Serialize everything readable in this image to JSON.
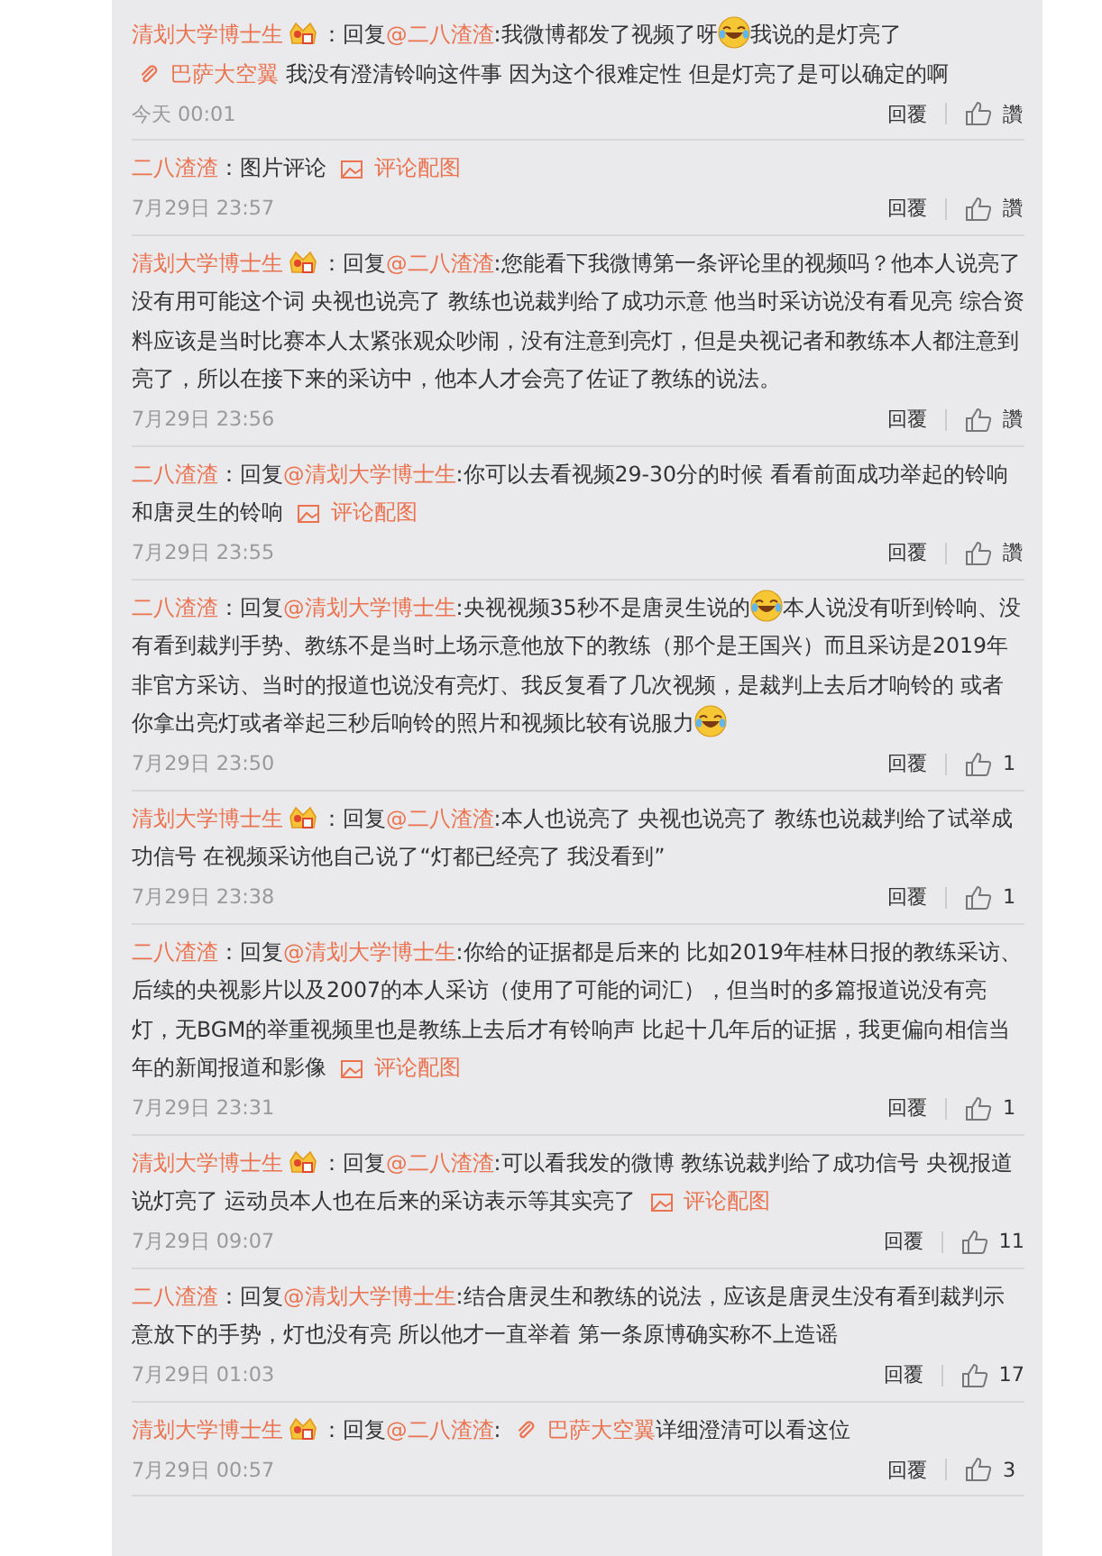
{
  "comments": [
    {
      "author": "清划大学博士生",
      "badge": true,
      "segments": [
        {
          "kind": "text",
          "text": "：回复"
        },
        {
          "kind": "mention",
          "text": "@二八渣渣"
        },
        {
          "kind": "text",
          "text": ":我微博都发了视频了呀"
        },
        {
          "kind": "emoji"
        },
        {
          "kind": "text",
          "text": "我说的是灯亮了 "
        },
        {
          "kind": "link",
          "text": "巴萨大空翼"
        },
        {
          "kind": "text",
          "text": " 我没有澄清铃响这件事 因为这个很难定性 但是灯亮了是可以确定的啊"
        }
      ],
      "time": "今天 00:01",
      "reply": "回覆",
      "likes": "讚"
    },
    {
      "author": "二八渣渣",
      "badge": false,
      "segments": [
        {
          "kind": "text",
          "text": "：图片评论 "
        },
        {
          "kind": "image_link",
          "text": "评论配图"
        }
      ],
      "time": "7月29日 23:57",
      "reply": "回覆",
      "likes": "讚"
    },
    {
      "author": "清划大学博士生",
      "badge": true,
      "segments": [
        {
          "kind": "text",
          "text": "：回复"
        },
        {
          "kind": "mention",
          "text": "@二八渣渣"
        },
        {
          "kind": "text",
          "text": ":您能看下我微博第一条评论里的视频吗？他本人说亮了没有用可能这个词 央视也说亮了 教练也说裁判给了成功示意 他当时采访说没有看见亮 综合资料应该是当时比赛本人太紧张观众吵闹，没有注意到亮灯，但是央视记者和教练本人都注意到亮了，所以在接下来的采访中，他本人才会亮了佐证了教练的说法。"
        }
      ],
      "time": "7月29日 23:56",
      "reply": "回覆",
      "likes": "讚"
    },
    {
      "author": "二八渣渣",
      "badge": false,
      "segments": [
        {
          "kind": "text",
          "text": "：回复"
        },
        {
          "kind": "mention",
          "text": "@清划大学博士生"
        },
        {
          "kind": "text",
          "text": ":你可以去看视频29-30分的时候 看看前面成功举起的铃响和唐灵生的铃响 "
        },
        {
          "kind": "image_link",
          "text": "评论配图"
        }
      ],
      "time": "7月29日 23:55",
      "reply": "回覆",
      "likes": "讚"
    },
    {
      "author": "二八渣渣",
      "badge": false,
      "segments": [
        {
          "kind": "text",
          "text": "：回复"
        },
        {
          "kind": "mention",
          "text": "@清划大学博士生"
        },
        {
          "kind": "text",
          "text": ":央视视频35秒不是唐灵生说的"
        },
        {
          "kind": "emoji"
        },
        {
          "kind": "text",
          "text": "本人说没有听到铃响、没有看到裁判手势、教练不是当时上场示意他放下的教练（那个是王国兴）而且采访是2019年非官方采访、当时的报道也说没有亮灯、我反复看了几次视频，是裁判上去后才响铃的 或者你拿出亮灯或者举起三秒后响铃的照片和视频比较有说服力"
        },
        {
          "kind": "emoji"
        }
      ],
      "time": "7月29日 23:50",
      "reply": "回覆",
      "likes": "1"
    },
    {
      "author": "清划大学博士生",
      "badge": true,
      "segments": [
        {
          "kind": "text",
          "text": "：回复"
        },
        {
          "kind": "mention",
          "text": "@二八渣渣"
        },
        {
          "kind": "text",
          "text": ":本人也说亮了 央视也说亮了 教练也说裁判给了试举成功信号 在视频采访他自己说了“灯都已经亮了 我没看到”"
        }
      ],
      "time": "7月29日 23:38",
      "reply": "回覆",
      "likes": "1"
    },
    {
      "author": "二八渣渣",
      "badge": false,
      "segments": [
        {
          "kind": "text",
          "text": "：回复"
        },
        {
          "kind": "mention",
          "text": "@清划大学博士生"
        },
        {
          "kind": "text",
          "text": ":你给的证据都是后来的 比如2019年桂林日报的教练采访、后续的央视影片以及2007的本人采访（使用了可能的词汇），但当时的多篇报道说没有亮灯，无BGM的举重视频里也是教练上去后才有铃响声 比起十几年后的证据，我更偏向相信当年的新闻报道和影像 "
        },
        {
          "kind": "image_link",
          "text": "评论配图"
        }
      ],
      "time": "7月29日 23:31",
      "reply": "回覆",
      "likes": "1"
    },
    {
      "author": "清划大学博士生",
      "badge": true,
      "segments": [
        {
          "kind": "text",
          "text": "：回复"
        },
        {
          "kind": "mention",
          "text": "@二八渣渣"
        },
        {
          "kind": "text",
          "text": ":可以看我发的微博 教练说裁判给了成功信号 央视报道说灯亮了 运动员本人也在后来的采访表示等其实亮了 "
        },
        {
          "kind": "image_link",
          "text": "评论配图"
        }
      ],
      "time": "7月29日 09:07",
      "reply": "回覆",
      "likes": "11"
    },
    {
      "author": "二八渣渣",
      "badge": false,
      "segments": [
        {
          "kind": "text",
          "text": "：回复"
        },
        {
          "kind": "mention",
          "text": "@清划大学博士生"
        },
        {
          "kind": "text",
          "text": ":结合唐灵生和教练的说法，应该是唐灵生没有看到裁判示意放下的手势，灯也没有亮 所以他才一直举着 第一条原博确实称不上造谣"
        }
      ],
      "time": "7月29日 01:03",
      "reply": "回覆",
      "likes": "17"
    },
    {
      "author": "清划大学博士生",
      "badge": true,
      "segments": [
        {
          "kind": "text",
          "text": "：回复"
        },
        {
          "kind": "mention",
          "text": "@二八渣渣"
        },
        {
          "kind": "text",
          "text": ": "
        },
        {
          "kind": "link",
          "text": "巴萨大空翼"
        },
        {
          "kind": "text",
          "text": "详细澄清可以看这位"
        }
      ],
      "time": "7月29日 00:57",
      "reply": "回覆",
      "likes": "3"
    }
  ]
}
